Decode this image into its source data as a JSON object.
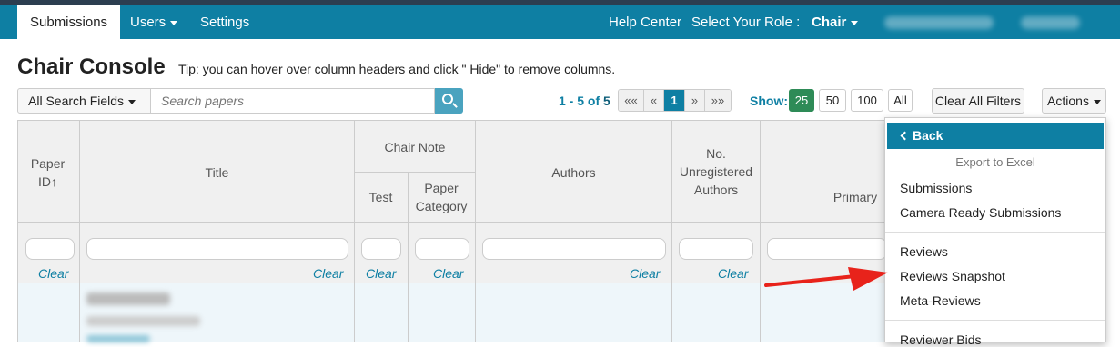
{
  "nav": {
    "submissions": "Submissions",
    "users": "Users",
    "settings": "Settings",
    "help_center": "Help Center",
    "select_role_label": "Select Your Role :",
    "role": "Chair"
  },
  "page": {
    "title": "Chair Console",
    "tip": "Tip: you can hover over column headers and click \" Hide\" to remove columns."
  },
  "search": {
    "field_dropdown": "All Search Fields",
    "placeholder": "Search papers"
  },
  "pagination": {
    "range": "1 - 5 of",
    "total": "5",
    "first": "««",
    "prev": "«",
    "current": "1",
    "next": "»",
    "last": "»»"
  },
  "show": {
    "label": "Show:",
    "options": [
      "25",
      "50",
      "100",
      "All"
    ],
    "selected": "25"
  },
  "toolbar": {
    "clear_filters": "Clear All Filters",
    "actions": "Actions"
  },
  "table": {
    "headers": {
      "paper_id": "Paper ID↑",
      "title": "Title",
      "chair_note": "Chair Note",
      "test": "Test",
      "paper_category": "Paper Category",
      "authors": "Authors",
      "unregistered": "No. Unregistered Authors",
      "primary": "Primary"
    },
    "clear_label": "Clear"
  },
  "actions_menu": {
    "back": "Back",
    "export_header": "Export to Excel",
    "items": [
      "Submissions",
      "Camera Ready Submissions",
      "Reviews",
      "Reviews Snapshot",
      "Meta-Reviews",
      "Reviewer Bids"
    ],
    "highlighted": "Reviews Snapshot",
    "highlight_color": "#ffff33"
  },
  "colors": {
    "navbar": "#0e7fa3",
    "accent": "#0e7fa3",
    "annotation_arrow": "#e8231b"
  }
}
